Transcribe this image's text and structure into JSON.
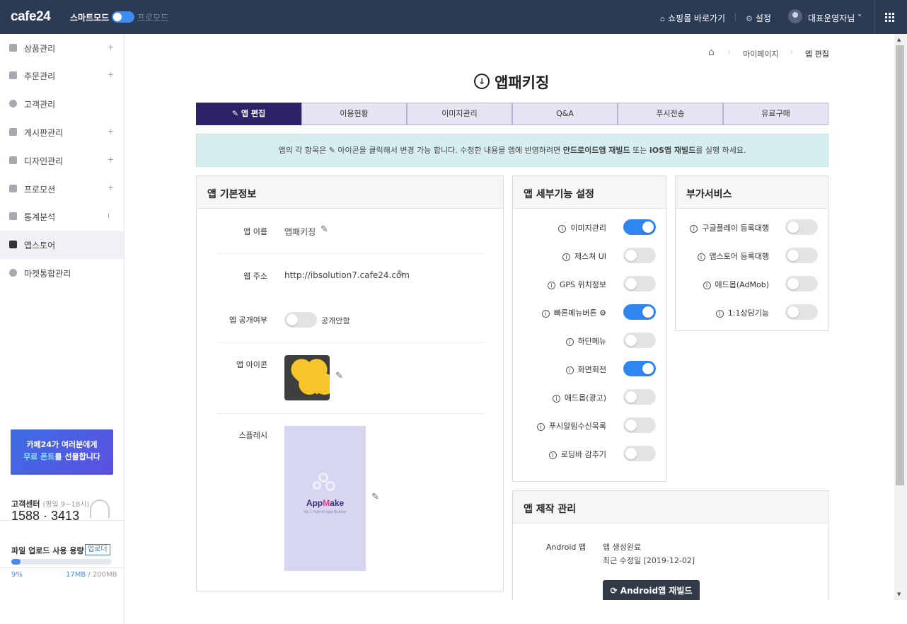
{
  "topbar": {
    "logo": "cafe24",
    "smart_mode": "스마트모드",
    "pro_mode": "프로모드",
    "shop_link": "쇼핑몰 바로가기",
    "settings": "설정",
    "user": "대표운영자님 ˅"
  },
  "sidebar": {
    "items": [
      {
        "label": "상품관리",
        "plus": "+"
      },
      {
        "label": "주문관리",
        "plus": "+"
      },
      {
        "label": "고객관리",
        "plus": ""
      },
      {
        "label": "게시판관리",
        "plus": "+"
      },
      {
        "label": "디자인관리",
        "plus": "+"
      },
      {
        "label": "프로모션",
        "plus": "+"
      },
      {
        "label": "통계분석",
        "plus": "ı"
      },
      {
        "label": "앱스토어",
        "plus": ""
      },
      {
        "label": "마켓통합관리",
        "plus": ""
      }
    ],
    "promo_line1": "카페24가 여러분에게",
    "promo_highlight": "무료 폰트",
    "promo_line2_rest": "를 선물합니다",
    "cs_title": "고객센터",
    "cs_hours": "(평일 9~18시)",
    "cs_phone": "1588 · 3413",
    "upload_title": "파일 업로드 사용 용량",
    "upload_button": "업로더",
    "upload_percent": "9%",
    "upload_used": "17MB",
    "upload_total": " / 200MB",
    "upload_fraction": 0.09
  },
  "breadcrumb": {
    "home": "⌂",
    "level1": "마이페이지",
    "level2": "앱 편집"
  },
  "page_title": "앱패키징",
  "tabs": [
    "앱 편집",
    "이용현황",
    "이미지관리",
    "Q&A",
    "푸시전송",
    "유료구매"
  ],
  "notice": {
    "part1": "앱의 각 항목은",
    "part2": "아이콘을 클릭해서 변경 가능 합니다.   수정한 내용을 앱에 반영하려면",
    "bold1": "안드로이드앱 재빌드",
    "part3": "또는",
    "bold2": "iOS앱 재빌드",
    "part4": "를 실행 하세요."
  },
  "basic_info": {
    "title": "앱 기본정보",
    "app_name_label": "앱 이름",
    "app_name": "앱패키징",
    "web_url_label": "웹 주소",
    "web_url": "http://ibsolution7.cafe24.com",
    "public_label": "앱 공개여부",
    "public_status": "공개안함",
    "icon_label": "앱 아이콘",
    "splash_label": "스플레시",
    "splash_logo_a": "App",
    "splash_logo_m": "M",
    "splash_logo_b": "ake",
    "splash_sub": "No.1 Hybrid App Builder"
  },
  "features": {
    "title": "앱 세부기능 설정",
    "items": [
      {
        "label": "이미지관리",
        "on": true
      },
      {
        "label": "제스쳐 UI",
        "on": false
      },
      {
        "label": "GPS 위치정보",
        "on": false
      },
      {
        "label": "빠른메뉴버튼 ⚙",
        "on": true
      },
      {
        "label": "하단메뉴",
        "on": false
      },
      {
        "label": "화면회전",
        "on": true
      },
      {
        "label": "애드몹(광고)",
        "on": false
      },
      {
        "label": "푸시알림수신목록",
        "on": false
      },
      {
        "label": "로딩바 감추기",
        "on": false
      }
    ]
  },
  "addons": {
    "title": "부가서비스",
    "items": [
      {
        "label": "구글플레이 등록대행",
        "on": false
      },
      {
        "label": "앱스토어 등록대행",
        "on": false
      },
      {
        "label": "애드몹(AdMob)",
        "on": false
      },
      {
        "label": "1:1상담기능",
        "on": false
      }
    ]
  },
  "production": {
    "title": "앱 제작 관리",
    "android_label": "Android 앱",
    "status": "앱 생성완료",
    "updated": "최근 수정일 [2019-12-02]",
    "rebuild_button": "Android앱 재빌드"
  },
  "colors": {
    "topbar": "#2b3a55",
    "tab_active": "#2d2266",
    "toggle_on": "#2f86f0",
    "notice_bg": "#d6eef0"
  }
}
